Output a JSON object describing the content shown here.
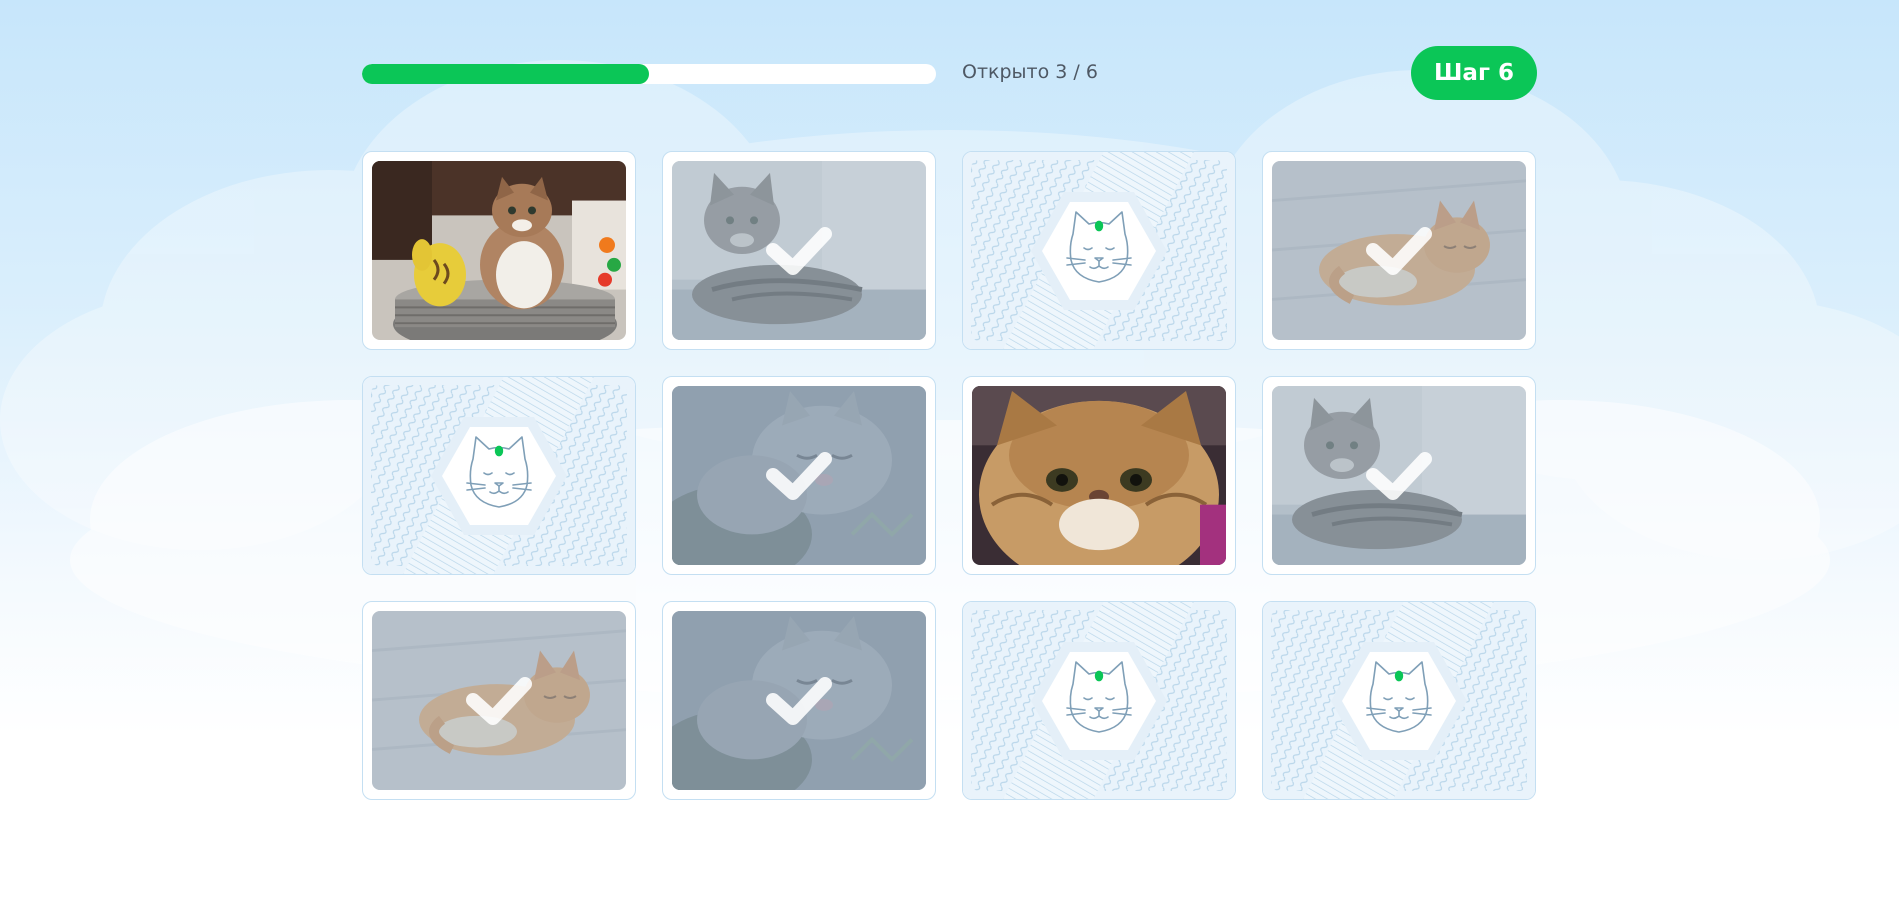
{
  "progress": {
    "opened": 3,
    "total": 6,
    "fraction": 0.5,
    "label": "Открыто 3 / 6"
  },
  "step": {
    "label": "Шаг 6"
  },
  "colors": {
    "accent": "#0bc657",
    "card_border": "#c4dff2",
    "back_pattern": "#b9d6ea",
    "cat_line": "#7f9fb7"
  },
  "cards": [
    {
      "state": "revealed",
      "cat": "tabby-in-basket"
    },
    {
      "state": "matched",
      "cat": "gray-tabby-on-sofa"
    },
    {
      "state": "hidden",
      "cat": null
    },
    {
      "state": "matched",
      "cat": "ginger-lying"
    },
    {
      "state": "hidden",
      "cat": null
    },
    {
      "state": "matched",
      "cat": "gray-british-sleeping"
    },
    {
      "state": "revealed",
      "cat": "persian-closeup"
    },
    {
      "state": "matched",
      "cat": "gray-tabby-on-sofa"
    },
    {
      "state": "matched",
      "cat": "ginger-lying"
    },
    {
      "state": "matched",
      "cat": "gray-british-sleeping"
    },
    {
      "state": "hidden",
      "cat": null
    },
    {
      "state": "hidden",
      "cat": null
    }
  ],
  "icons": {
    "card_back": "cat-face-icon",
    "matched": "check-icon"
  }
}
